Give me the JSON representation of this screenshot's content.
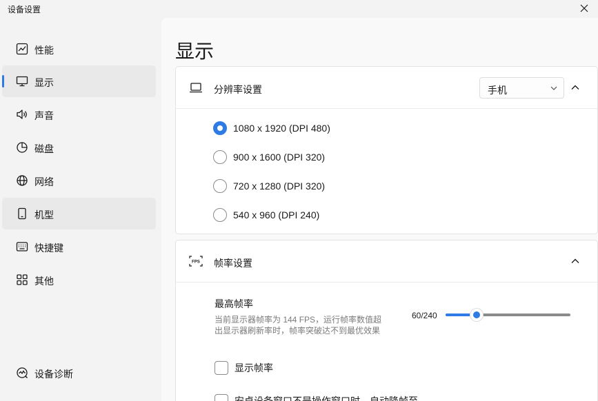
{
  "window": {
    "title": "设备设置"
  },
  "sidebar": {
    "items": [
      {
        "label": "性能",
        "icon": "performance-chart-icon"
      },
      {
        "label": "显示",
        "icon": "monitor-icon",
        "active": true
      },
      {
        "label": "声音",
        "icon": "speaker-icon"
      },
      {
        "label": "磁盘",
        "icon": "pie-chart-icon"
      },
      {
        "label": "网络",
        "icon": "globe-icon"
      },
      {
        "label": "机型",
        "icon": "phone-icon"
      },
      {
        "label": "快捷键",
        "icon": "keyboard-icon"
      },
      {
        "label": "其他",
        "icon": "grid-icon"
      }
    ],
    "diagnostics": {
      "label": "设备诊断",
      "icon": "diagnostics-icon"
    }
  },
  "main": {
    "title": "显示",
    "resolution": {
      "title": "分辨率设置",
      "select_value": "手机",
      "options": [
        {
          "label": "1080 x 1920 (DPI 480)",
          "checked": true
        },
        {
          "label": "900 x 1600 (DPI 320)",
          "checked": false
        },
        {
          "label": "720 x 1280 (DPI 320)",
          "checked": false
        },
        {
          "label": "540 x 960 (DPI 240)",
          "checked": false
        }
      ]
    },
    "framerate": {
      "title": "帧率设置",
      "icon_text": "FPS",
      "max_label": "最高帧率",
      "description": "当前显示器帧率为 144 FPS，运行帧率数值超出显示器刷新率时，帧率突破达不到最优效果",
      "value_text": "60/240",
      "value": 60,
      "max": 240,
      "show_fps_label": "显示帧率",
      "auto_reduce_label": "安卓设备窗口不是操作窗口时，自动降帧至"
    }
  },
  "colors": {
    "accent": "#2e7be6",
    "sidebar_bg": "#f3f3f3",
    "content_bg": "#f9f9f9"
  }
}
